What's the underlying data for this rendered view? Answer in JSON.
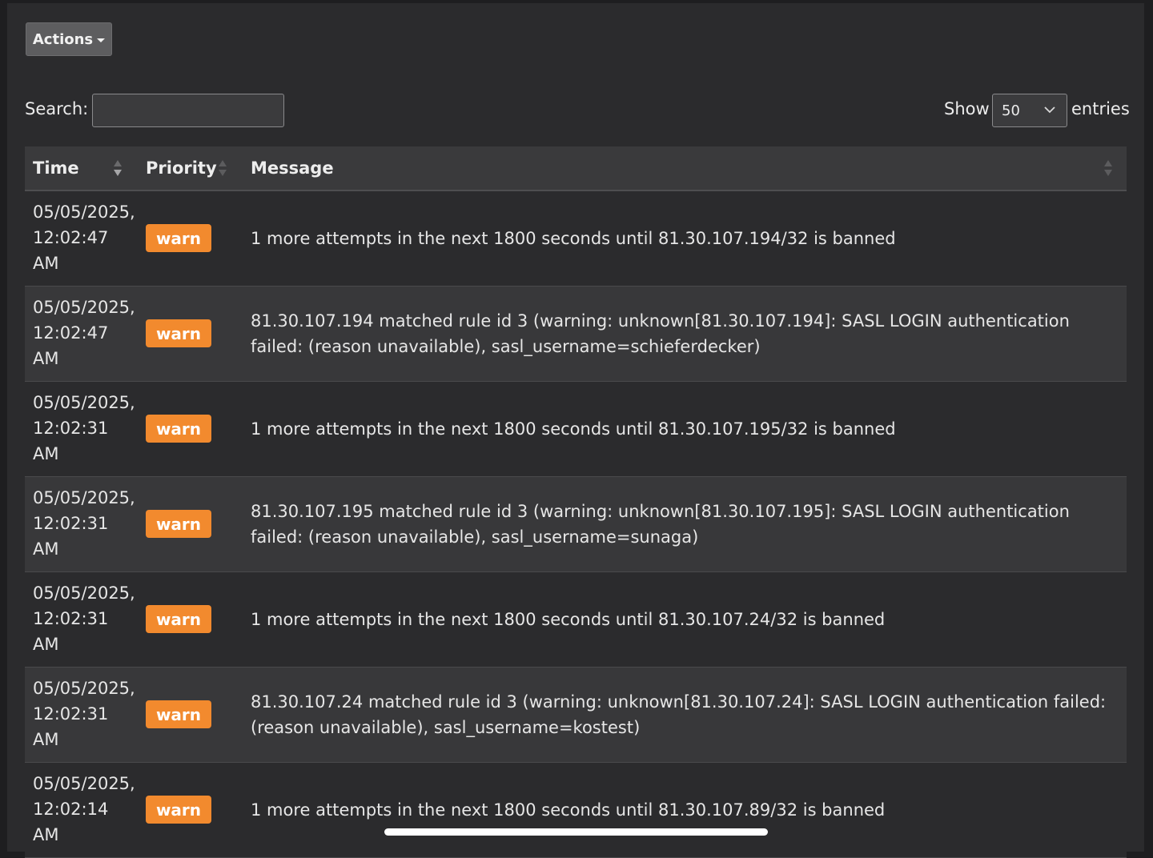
{
  "toolbar": {
    "actions_label": "Actions"
  },
  "search": {
    "label": "Search:",
    "value": "",
    "placeholder": ""
  },
  "length": {
    "show_label": "Show",
    "selected": "50",
    "entries_label": "entries"
  },
  "table": {
    "columns": [
      "Time",
      "Priority",
      "Message"
    ],
    "rows": [
      {
        "time_line1": "05/05/2025,",
        "time_line2": "12:02:47",
        "time_line3": "AM",
        "priority": "warn",
        "message": "1 more attempts in the next 1800 seconds until 81.30.107.194/32 is banned"
      },
      {
        "time_line1": "05/05/2025,",
        "time_line2": "12:02:47",
        "time_line3": "AM",
        "priority": "warn",
        "message": "81.30.107.194 matched rule id 3 (warning: unknown[81.30.107.194]: SASL LOGIN authentication failed: (reason unavailable), sasl_username=schieferdecker)"
      },
      {
        "time_line1": "05/05/2025,",
        "time_line2": "12:02:31",
        "time_line3": "AM",
        "priority": "warn",
        "message": "1 more attempts in the next 1800 seconds until 81.30.107.195/32 is banned"
      },
      {
        "time_line1": "05/05/2025,",
        "time_line2": "12:02:31",
        "time_line3": "AM",
        "priority": "warn",
        "message": "81.30.107.195 matched rule id 3 (warning: unknown[81.30.107.195]: SASL LOGIN authentication failed: (reason unavailable), sasl_username=sunaga)"
      },
      {
        "time_line1": "05/05/2025,",
        "time_line2": "12:02:31",
        "time_line3": "AM",
        "priority": "warn",
        "message": "1 more attempts in the next 1800 seconds until 81.30.107.24/32 is banned"
      },
      {
        "time_line1": "05/05/2025,",
        "time_line2": "12:02:31",
        "time_line3": "AM",
        "priority": "warn",
        "message": "81.30.107.24 matched rule id 3 (warning: unknown[81.30.107.24]: SASL LOGIN authentication failed: (reason unavailable), sasl_username=kostest)"
      },
      {
        "time_line1": "05/05/2025,",
        "time_line2": "12:02:14",
        "time_line3": "AM",
        "priority": "warn",
        "message": "1 more attempts in the next 1800 seconds until 81.30.107.89/32 is banned"
      }
    ]
  },
  "icons": {
    "actions_caret": "caret-down-icon",
    "select_chevron": "chevron-down-icon",
    "sort": "sort-both-icon"
  },
  "colors": {
    "warn_badge": "#f28a2e",
    "background": "#2b2b2d",
    "row_alt": "#38383a"
  }
}
